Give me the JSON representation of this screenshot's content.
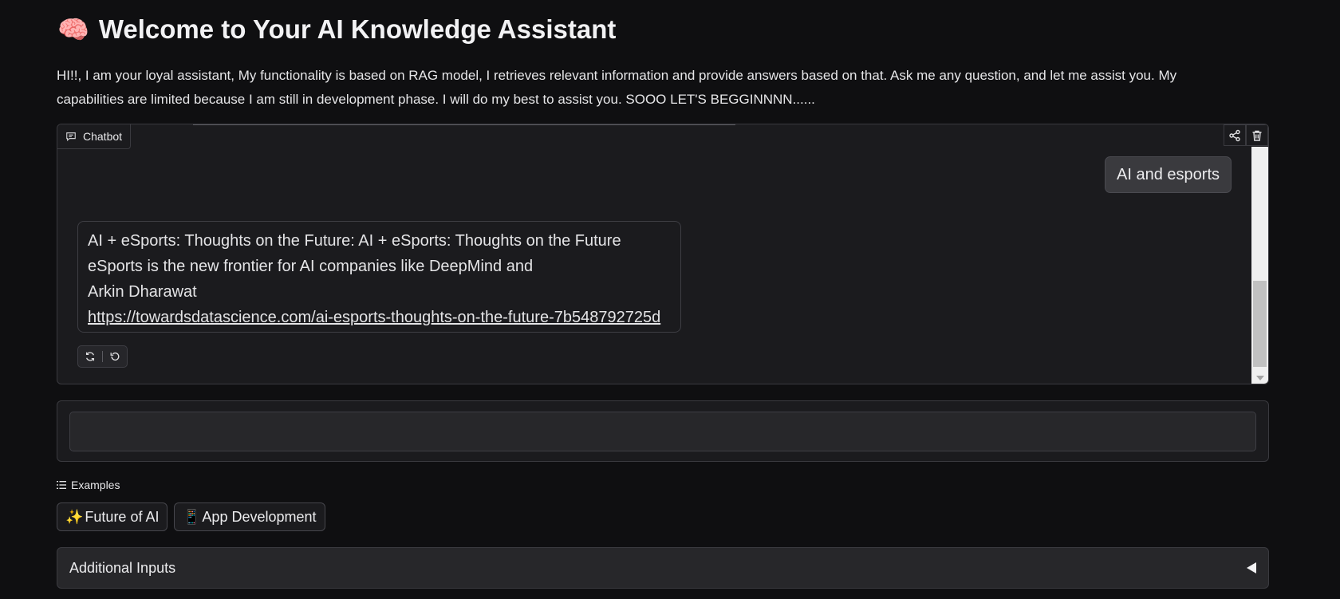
{
  "header": {
    "title_icon": "🧠",
    "title": "Welcome to Your AI Knowledge Assistant",
    "intro": "HI!!, I am your loyal assistant, My functionality is based on RAG model, I retrieves relevant information and provide answers based on that. Ask me any question, and let me assist you. My capabilities are limited because I am still in development phase. I will do my best to assist you. SOOO LET'S BEGGINNNN......"
  },
  "chatbot": {
    "label": "Chatbot",
    "label_icon": "chat-icon",
    "share_icon": "share-icon",
    "delete_icon": "trash-icon",
    "user_message": "AI and esports",
    "bot_message": {
      "line1": "AI + eSports: Thoughts on the Future: AI + eSports: Thoughts on the Future",
      "line2": "eSports is the new frontier for AI companies like DeepMind and",
      "line3": "Arkin Dharawat",
      "link": "https://towardsdatascience.com/ai-esports-thoughts-on-the-future-7b548792725d"
    },
    "retry_icon": "retry-icon",
    "undo_icon": "undo-icon"
  },
  "input": {
    "value": "",
    "placeholder": ""
  },
  "examples": {
    "label": "Examples",
    "label_icon": "list-icon",
    "items": [
      {
        "emoji": "✨",
        "label": "Future of AI"
      },
      {
        "emoji": "📱",
        "label": "App Development"
      }
    ]
  },
  "additional_inputs": {
    "label": "Additional Inputs",
    "toggle_icon": "triangle-left-icon"
  },
  "colors": {
    "background": "#0f0f11",
    "panel": "#1b1b1e",
    "border": "#3a3a3f",
    "text": "#e8e8ea"
  }
}
